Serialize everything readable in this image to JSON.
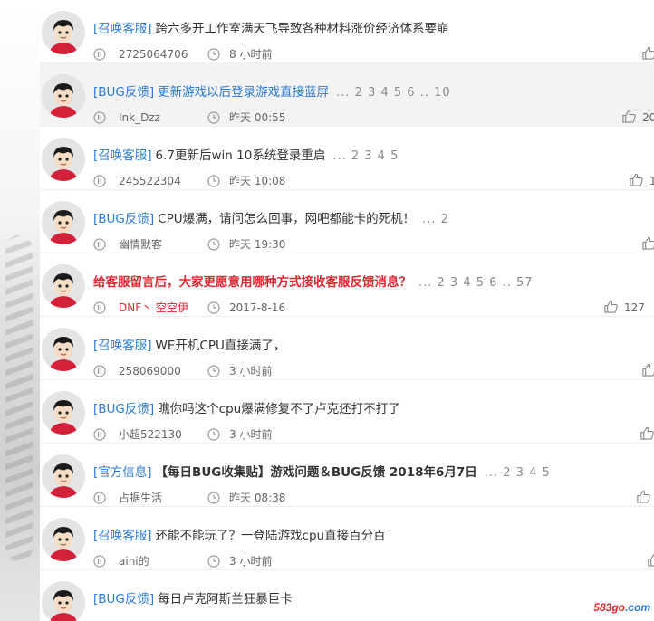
{
  "threads": [
    {
      "tag": "[召唤客服]",
      "title": "跨六多开工作室满天飞导致各种材料涨价经济体系要崩",
      "pages": "",
      "author": "2725064706",
      "time": "8 小时前",
      "likes": "",
      "style": "normal"
    },
    {
      "tag": "[BUG反馈]",
      "title": "更新游戏以后登录游戏直接蓝屏",
      "pages": "... 2 3 4 5 6 .. 10",
      "author": "Ink_Dzz",
      "time": "昨天 00:55",
      "likes": "20",
      "style": "blue"
    },
    {
      "tag": "[召唤客服]",
      "title": "6.7更新后win 10系统登录重启",
      "pages": "... 2 3 4 5",
      "author": "245522304",
      "time": "昨天 10:08",
      "likes": "1",
      "style": "normal"
    },
    {
      "tag": "[BUG反馈]",
      "title": "CPU爆满，请问怎么回事，网吧都能卡的死机！",
      "pages": "... 2",
      "author": "幽情默客",
      "time": "昨天 19:30",
      "likes": "",
      "style": "normal"
    },
    {
      "tag": "",
      "title": "给客服留言后，大家更愿意用哪种方式接收客服反馈消息？",
      "pages": "... 2 3 4 5 6 .. 57",
      "author": "DNF丶 空空伊",
      "time": "2017-8-16",
      "likes": "127",
      "style": "red"
    },
    {
      "tag": "[召唤客服]",
      "title": "WE开机CPU直接满了，",
      "pages": "",
      "author": "258069000",
      "time": "3 小时前",
      "likes": "",
      "style": "normal"
    },
    {
      "tag": "[BUG反馈]",
      "title": "瞧你吗这个cpu爆满修复不了卢克还打不打了",
      "pages": "",
      "author": "小超522130",
      "time": "3 小时前",
      "likes": "",
      "style": "normal"
    },
    {
      "tag": "[官方信息]",
      "title": "【每日BUG收集贴】游戏问题＆BUG反馈 2018年6月7日",
      "pages": "... 2 3 4 5",
      "author": "占据生活",
      "time": "昨天 08:38",
      "likes": "",
      "style": "bold"
    },
    {
      "tag": "[召唤客服]",
      "title": "还能不能玩了？一登陆游戏cpu直接百分百",
      "pages": "",
      "author": "aini的",
      "time": "3 小时前",
      "likes": "",
      "style": "normal"
    },
    {
      "tag": "[BUG反馈]",
      "title": "每日卢克阿斯兰狂暴巨卡",
      "pages": "",
      "author": "",
      "time": "",
      "likes": "",
      "style": "normal"
    }
  ],
  "icons": {
    "user": "user-icon",
    "clock": "clock-icon",
    "like": "thumbs-up-icon"
  },
  "watermark": {
    "part_a": "583go",
    "part_b": ".com"
  },
  "colors": {
    "tag": "#2b7bd6",
    "pinned": "#e0262e",
    "text": "#333333",
    "meta": "#666666"
  }
}
